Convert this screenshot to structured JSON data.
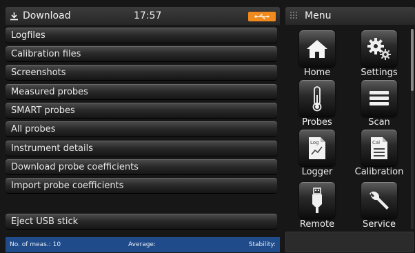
{
  "header": {
    "title": "Download",
    "time": "17:57"
  },
  "list": {
    "items": [
      "Logfiles",
      "Calibration files",
      "Screenshots",
      "Measured probes",
      "SMART probes",
      "All probes",
      "Instrument details",
      "Download probe coefficients",
      "Import probe coefficients"
    ],
    "eject": "Eject USB stick"
  },
  "status": {
    "meas": "No. of meas.: 10",
    "average": "Average:",
    "stability": "Stability:"
  },
  "menu": {
    "title": "Menu",
    "tiles": [
      "Home",
      "Settings",
      "Probes",
      "Scan",
      "Logger",
      "Calibration",
      "Remote",
      "Service"
    ],
    "logger_icon_text": "Log",
    "calibration_icon_text": "Cal"
  },
  "colors": {
    "status_bar": "#1f4b8a",
    "usb_badge": "#f08a1c"
  }
}
